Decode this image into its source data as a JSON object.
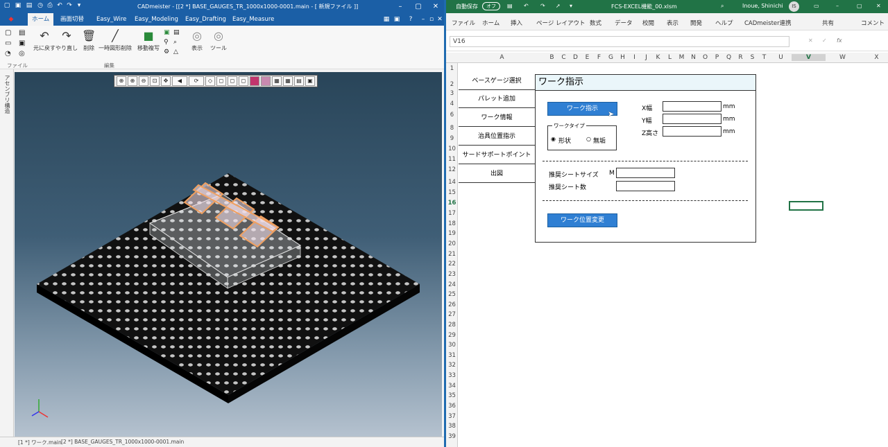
{
  "cad": {
    "title": "CADmeister - [[2 *] BASE_GAUGES_TR_1000x1000-0001.main - [ 新規ファイル ]]",
    "tabs": [
      "ホーム",
      "画面切替",
      "Easy_Wire",
      "Easy_Modeling",
      "Easy_Drafting",
      "Easy_Measure"
    ],
    "ribbon": {
      "undo": "元に戻す",
      "redo": "やり直し",
      "delete": "削除",
      "temp_delete": "一時図形削除",
      "move_copy": "移動複写",
      "display": "表示",
      "tool": "ツール",
      "group_file": "ファイル",
      "group_edit": "編集"
    },
    "sidebar_label": "アセンブリ構造",
    "status_tabs": [
      "[1 *] ワーク.main",
      "[2 *] BASE_GAUGES_TR_1000x1000-0001.main"
    ]
  },
  "excel": {
    "autosave": "自動保存",
    "autosave_state": "オフ",
    "filename": "FCS-EXCEL機能_00.xlsm",
    "user": "Inoue, Shinichi",
    "user_initials": "IS",
    "menu": [
      "ファイル",
      "ホーム",
      "挿入",
      "ページ レイアウト",
      "数式",
      "データ",
      "校閲",
      "表示",
      "開発",
      "ヘルプ",
      "CADmeister連携"
    ],
    "share": "共有",
    "comment": "コメント",
    "name_box": "V16",
    "fx": "fx",
    "columns": [
      "A",
      "B",
      "C",
      "D",
      "E",
      "F",
      "G",
      "H",
      "I",
      "J",
      "K",
      "L",
      "M",
      "N",
      "O",
      "P",
      "Q",
      "R",
      "S",
      "T",
      "U",
      "V",
      "W",
      "X"
    ],
    "rows": [
      "1",
      "2",
      "3",
      "4",
      "5",
      "6",
      "7",
      "8",
      "9",
      "10",
      "11",
      "12",
      "13",
      "14",
      "15",
      "16",
      "17",
      "18",
      "19",
      "20",
      "21",
      "22",
      "23",
      "24",
      "25",
      "26",
      "27",
      "28",
      "29",
      "30",
      "31",
      "32",
      "33",
      "34",
      "35",
      "36",
      "37",
      "38",
      "39"
    ],
    "left_menu": [
      "ベースゲージ選択",
      "パレット追加",
      "ワーク情報",
      "治具位置指示",
      "サードサポートポイント",
      "出図"
    ],
    "panel": {
      "title": "ワーク指示",
      "work_button": "ワーク指示",
      "work_type_label": "ワークタイプ",
      "radio_shape": "形状",
      "radio_none": "無垢",
      "x_label": "X幅",
      "y_label": "Y幅",
      "z_label": "Z高さ",
      "unit": "mm",
      "sheet_size_label": "推奨シートサイズ",
      "sheet_size_prefix": "M",
      "sheet_count_label": "推奨シート数",
      "move_button": "ワーク位置変更"
    }
  },
  "colors": {
    "cad_blue": "#1b5fa6",
    "excel_green": "#217346",
    "button_blue": "#2f7fd3"
  }
}
